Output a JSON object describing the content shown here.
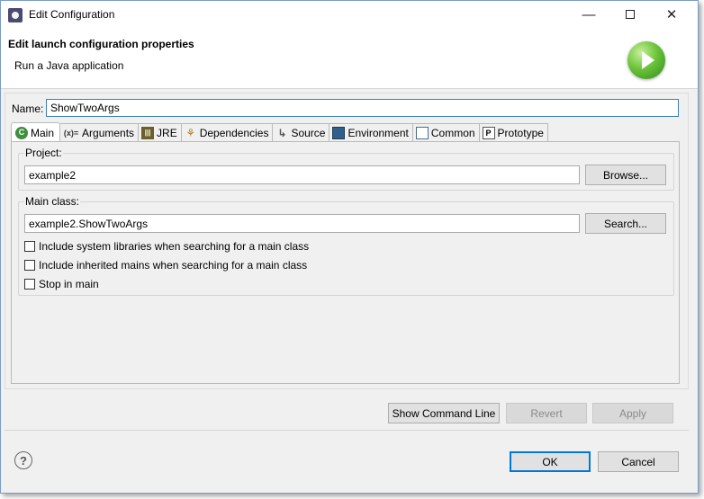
{
  "window": {
    "title": "Edit Configuration",
    "minimize_icon": "minimize-icon",
    "maximize_icon": "maximize-icon",
    "close_icon": "close-icon"
  },
  "header": {
    "title": "Edit launch configuration properties",
    "subtitle": "Run a Java application",
    "badge_icon": "run-play-icon"
  },
  "name": {
    "label": "Name:",
    "value": "ShowTwoArgs"
  },
  "tabs": [
    {
      "label": "Main",
      "icon": "main-tab-icon",
      "active": true
    },
    {
      "label": "Arguments",
      "icon": "arguments-icon"
    },
    {
      "label": "JRE",
      "icon": "jre-icon"
    },
    {
      "label": "Dependencies",
      "icon": "dependencies-icon"
    },
    {
      "label": "Source",
      "icon": "source-icon"
    },
    {
      "label": "Environment",
      "icon": "environment-icon"
    },
    {
      "label": "Common",
      "icon": "common-icon"
    },
    {
      "label": "Prototype",
      "icon": "prototype-icon"
    }
  ],
  "project": {
    "label": "Project:",
    "value": "example2",
    "browse_label": "Browse..."
  },
  "main_class": {
    "label": "Main class:",
    "value": "example2.ShowTwoArgs",
    "search_label": "Search..."
  },
  "options": [
    {
      "label": "Include system libraries when searching for a main class",
      "checked": false
    },
    {
      "label": "Include inherited mains when searching for a main class",
      "checked": false
    },
    {
      "label": "Stop in main",
      "checked": false
    }
  ],
  "actions": {
    "show_command_line": "Show Command Line",
    "revert": "Revert",
    "apply": "Apply"
  },
  "footer": {
    "ok": "OK",
    "cancel": "Cancel",
    "help": "?"
  },
  "colors": {
    "accent": "#0078d7",
    "run_green": "#4cae2c"
  }
}
